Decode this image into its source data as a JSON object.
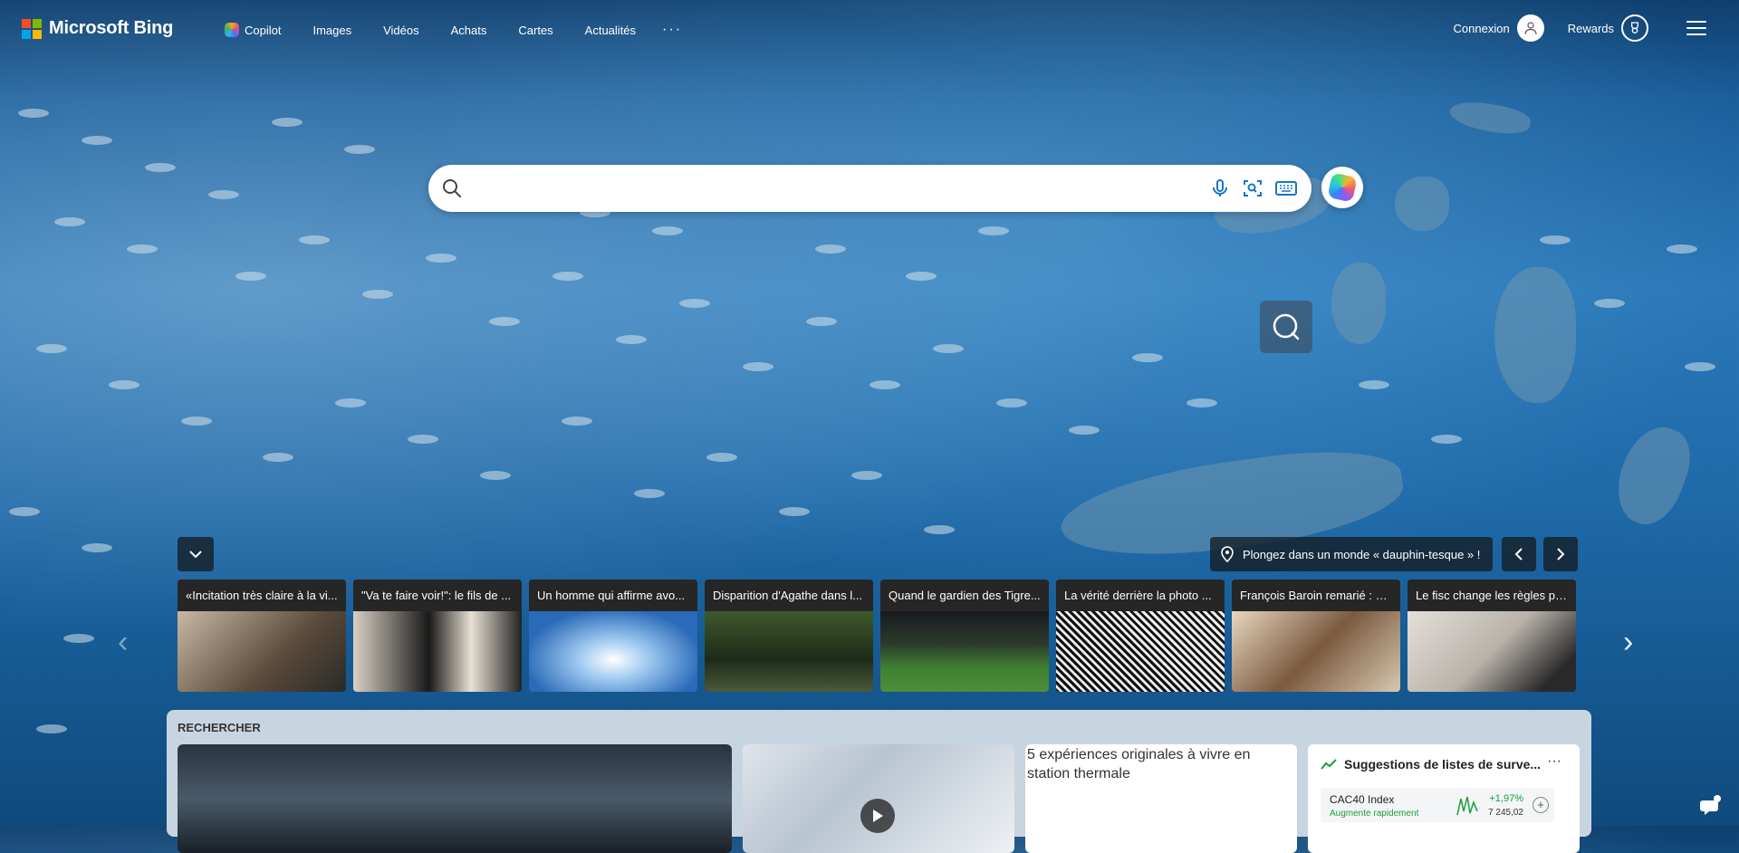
{
  "header": {
    "brand": "Microsoft Bing",
    "brand_colors": [
      "#f25022",
      "#7fba00",
      "#00a4ef",
      "#ffb900"
    ],
    "nav": [
      {
        "label": "Copilot",
        "icon": "copilot-icon"
      },
      {
        "label": "Images"
      },
      {
        "label": "Vidéos"
      },
      {
        "label": "Achats"
      },
      {
        "label": "Cartes"
      },
      {
        "label": "Actualités"
      }
    ],
    "more_label": "···",
    "signin_label": "Connexion",
    "rewards_label": "Rewards"
  },
  "search": {
    "placeholder": "",
    "icons": [
      "search-icon",
      "microphone-icon",
      "visual-search-icon",
      "keyboard-icon",
      "copilot-icon"
    ]
  },
  "image_info": {
    "caption": "Plongez dans un monde « dauphin-tesque » !",
    "icon": "location-pin-icon"
  },
  "news": [
    {
      "title": "«Incitation très claire à la vi...",
      "thumb": "#8a7a6a"
    },
    {
      "title": "\"Va te faire voir!\": le fils de ...",
      "thumb": "#3a3a3a"
    },
    {
      "title": "Un homme qui affirme avo...",
      "thumb": "#4a7fc0"
    },
    {
      "title": "Disparition d'Agathe dans l...",
      "thumb": "#3d5a2c"
    },
    {
      "title": "Quand le gardien des Tigre...",
      "thumb": "#4d7a3a"
    },
    {
      "title": "La vérité derrière la photo ...",
      "thumb": "#888888"
    },
    {
      "title": "François Baroin remarié : L'...",
      "thumb": "#8a7055"
    },
    {
      "title": "Le fisc change les règles po...",
      "thumb": "#c9c4bc"
    }
  ],
  "feed": {
    "heading": "RECHERCHER",
    "card3_alt": "5 expériences originales à vivre en station thermale",
    "watchlist": {
      "title": "Suggestions de listes de surve...",
      "more": "···",
      "item": {
        "name": "CAC40 Index",
        "sub": "Augmente rapidement",
        "change": "+1,97%",
        "value": "7 245,02",
        "accent": "#1a9e3a"
      }
    }
  }
}
